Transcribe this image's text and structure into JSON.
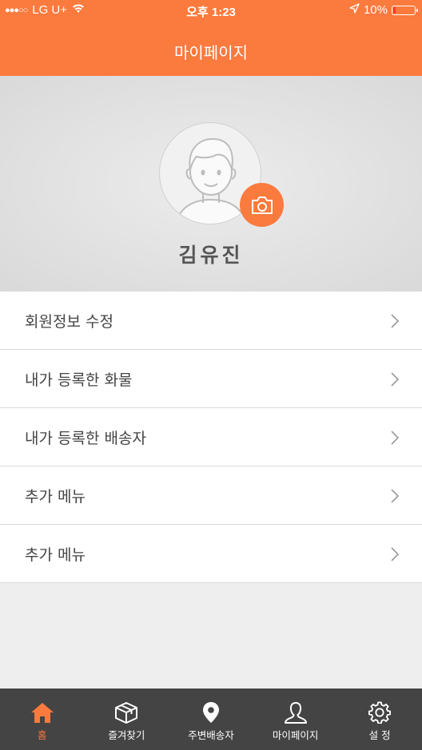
{
  "status_bar": {
    "carrier": "LG U+",
    "time": "오후 1:23",
    "battery": "10%"
  },
  "header": {
    "title": "마이페이지"
  },
  "profile": {
    "name": "김유진"
  },
  "menu": {
    "items": [
      {
        "label": "회원정보 수정"
      },
      {
        "label": "내가 등록한 화물"
      },
      {
        "label": "내가 등록한 배송자"
      },
      {
        "label": "추가 메뉴"
      },
      {
        "label": "추가 메뉴"
      }
    ]
  },
  "tabbar": {
    "tabs": [
      {
        "label": "홈",
        "icon": "home-icon",
        "active": true
      },
      {
        "label": "즐겨찾기",
        "icon": "box-icon"
      },
      {
        "label": "주변배송자",
        "icon": "location-pin-icon"
      },
      {
        "label": "마이페이지",
        "icon": "person-icon"
      },
      {
        "label": "설 정",
        "icon": "gear-icon"
      }
    ]
  },
  "colors": {
    "accent": "#fb7a3d",
    "tabbar_bg": "#444444"
  }
}
